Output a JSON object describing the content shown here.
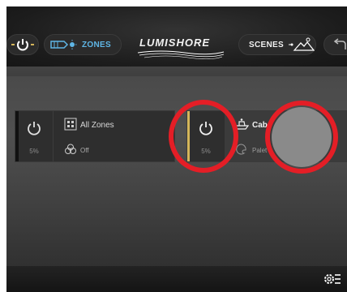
{
  "header": {
    "zones_label": "ZONES",
    "logo_text": "LUMISHORE",
    "scenes_label": "SCENES"
  },
  "zones": [
    {
      "name": "All Zones",
      "status": "Off",
      "brightness": "5%",
      "icon": "grid-icon",
      "status_icon": "color-rings-icon"
    },
    {
      "name": "Cab",
      "status": "Palet",
      "brightness": "5%",
      "icon": "boat-icon",
      "status_icon": "palette-icon"
    }
  ],
  "colors": {
    "accent_blue": "#5fb6e6",
    "accent_gold": "#d4b65a",
    "highlight_red": "#e41e26"
  },
  "icons": {
    "power": "power-icon",
    "zones": "spotlight-icon",
    "scenes": "mountain-icon",
    "back": "back-arrow-icon",
    "settings": "gear-icon"
  }
}
